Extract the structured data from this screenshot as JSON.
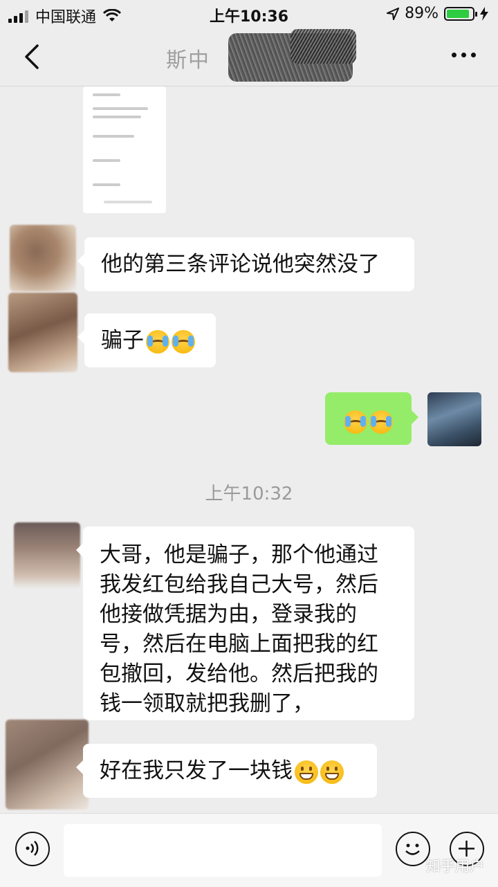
{
  "status": {
    "carrier": "中国联通",
    "time": "上午10:36",
    "battery": "89%",
    "battery_level": 0.89
  },
  "header": {
    "title": "斯中"
  },
  "messages": [
    {
      "side": "left",
      "text": "他的第三条评论说他突然没了"
    },
    {
      "side": "left",
      "text": "骗子",
      "emoji": "cry-laugh"
    },
    {
      "side": "right",
      "emoji": "cry-laugh"
    },
    {
      "side": "left",
      "text": "大哥，他是骗子，那个他通过我发红包给我自己大号，然后他接做凭据为由，登录我的号，然后在电脑上面把我的红包撤回，发给他。然后把我的钱一领取就把我删了，"
    },
    {
      "side": "left",
      "text": "好在我只发了一块钱",
      "emoji": "grin"
    }
  ],
  "timestamp": "上午10:32",
  "input": {
    "placeholder": ""
  },
  "watermark": "知乎用户",
  "colors": {
    "accent_green": "#95ec69",
    "background": "#ededed"
  },
  "icons": {
    "voice": "voice-icon",
    "emoji": "emoji-icon",
    "plus": "plus-icon"
  }
}
